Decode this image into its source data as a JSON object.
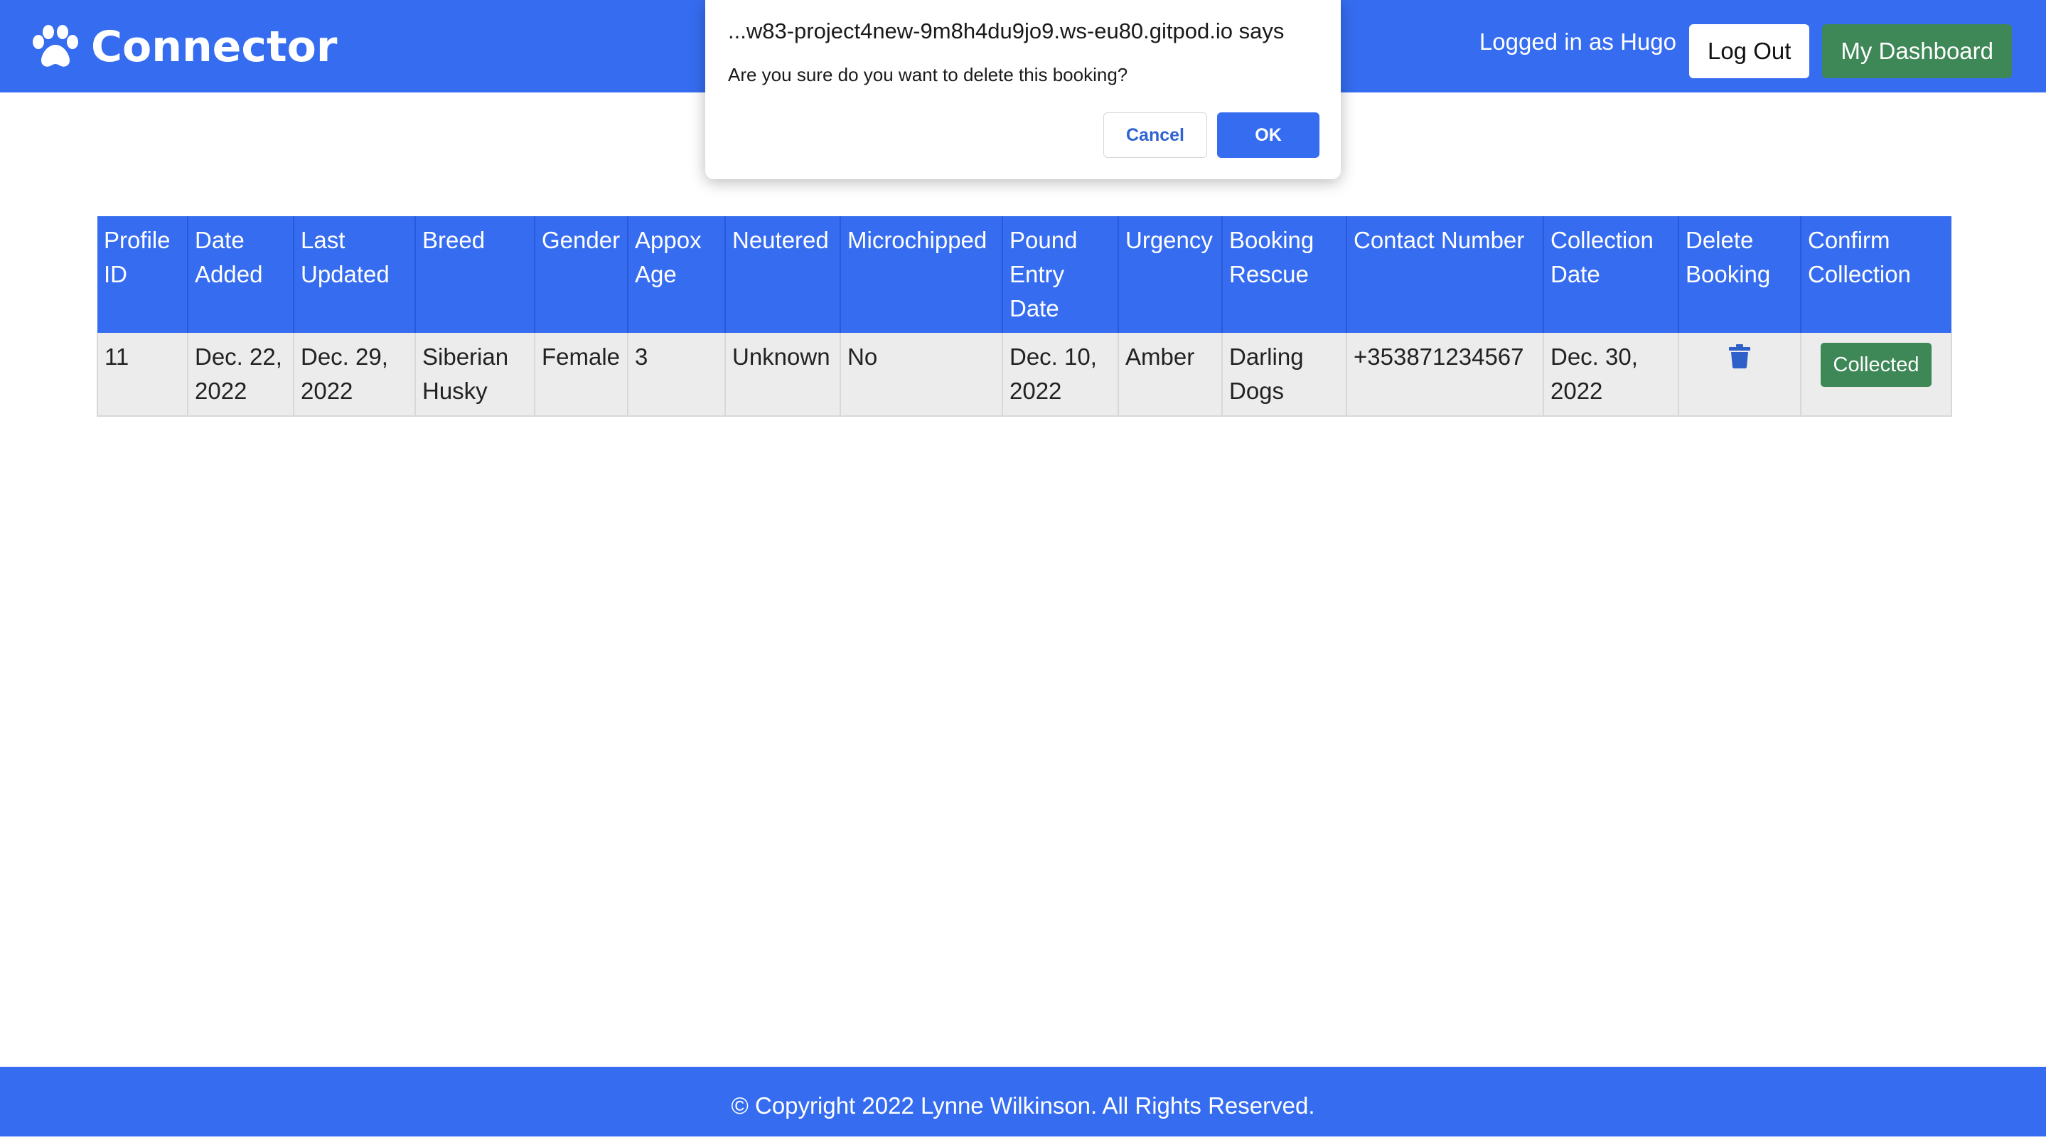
{
  "header": {
    "brand": "Connector",
    "logged_in_text": "Logged in as Hugo",
    "logout_label": "Log Out",
    "dashboard_label": "My Dashboard",
    "brand_icon": "paw-icon"
  },
  "table": {
    "headers": [
      "Profile ID",
      "Date Added",
      "Last Updated",
      "Breed",
      "Gender",
      "Appox Age",
      "Neutered",
      "Microchipped",
      "Pound Entry Date",
      "Urgency",
      "Booking Rescue",
      "Contact Number",
      "Collection Date",
      "Delete Booking",
      "Confirm Collection"
    ],
    "rows": [
      {
        "profile_id": "11",
        "date_added": "Dec. 22, 2022",
        "last_updated": "Dec. 29, 2022",
        "breed": "Siberian Husky",
        "gender": "Female",
        "age": "3",
        "neutered": "Unknown",
        "microchipped": "No",
        "pound_entry_date": "Dec. 10, 2022",
        "urgency": "Amber",
        "booking_rescue": "Darling Dogs",
        "contact_number": "+353871234567",
        "collection_date": "Dec. 30, 2022",
        "delete_icon": "trash-icon",
        "collected_label": "Collected"
      }
    ]
  },
  "footer": {
    "copyright": "© Copyright 2022 Lynne Wilkinson. All Rights Reserved."
  },
  "dialog": {
    "title": "...w83-project4new-9m8h4du9jo9.ws-eu80.gitpod.io says",
    "message": "Are you sure do you want to delete this booking?",
    "cancel_label": "Cancel",
    "ok_label": "OK"
  },
  "colors": {
    "primary": "#356cf0",
    "success": "#3e8757",
    "row_bg": "#ececec"
  }
}
